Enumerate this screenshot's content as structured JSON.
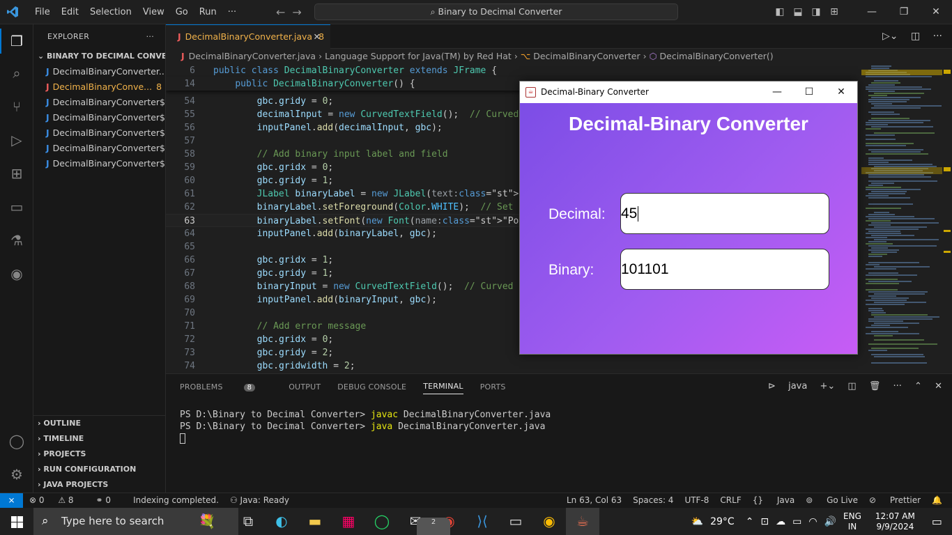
{
  "titlebar": {
    "menu": [
      "File",
      "Edit",
      "Selection",
      "View",
      "Go",
      "Run",
      "···"
    ],
    "command_center": "Binary to Decimal Converter"
  },
  "sidebar": {
    "header": "EXPLORER",
    "more": "···",
    "folder": "BINARY TO DECIMAL CONVER...",
    "files": [
      {
        "name": "DecimalBinaryConverter....",
        "error": false,
        "badge": ""
      },
      {
        "name": "DecimalBinaryConve...",
        "error": true,
        "badge": "8"
      },
      {
        "name": "DecimalBinaryConverter$...",
        "error": false,
        "badge": ""
      },
      {
        "name": "DecimalBinaryConverter$...",
        "error": false,
        "badge": ""
      },
      {
        "name": "DecimalBinaryConverter$...",
        "error": false,
        "badge": ""
      },
      {
        "name": "DecimalBinaryConverter$...",
        "error": false,
        "badge": ""
      },
      {
        "name": "DecimalBinaryConverter$...",
        "error": false,
        "badge": ""
      }
    ],
    "bottom_sections": [
      "OUTLINE",
      "TIMELINE",
      "PROJECTS",
      "RUN CONFIGURATION",
      "JAVA PROJECTS"
    ]
  },
  "editor": {
    "tab_label": "DecimalBinaryConverter.java",
    "tab_badge": "8",
    "breadcrumb": [
      "DecimalBinaryConverter.java",
      "Language Support for Java(TM) by Red Hat",
      "DecimalBinaryConverter",
      "DecimalBinaryConverter()"
    ],
    "sticky_lines": [
      {
        "n": "6",
        "code": "public class DecimalBinaryConverter extends JFrame {"
      },
      {
        "n": "14",
        "code": "    public DecimalBinaryConverter() {"
      }
    ],
    "lines": [
      {
        "n": "54",
        "code": "        gbc.gridy = 0;"
      },
      {
        "n": "55",
        "code": "        decimalInput = new CurvedTextField();  // Curved"
      },
      {
        "n": "56",
        "code": "        inputPanel.add(decimalInput, gbc);"
      },
      {
        "n": "57",
        "code": ""
      },
      {
        "n": "58",
        "code": "        // Add binary input label and field"
      },
      {
        "n": "59",
        "code": "        gbc.gridx = 0;"
      },
      {
        "n": "60",
        "code": "        gbc.gridy = 1;"
      },
      {
        "n": "61",
        "code": "        JLabel binaryLabel = new JLabel(text:\"Binary:\");"
      },
      {
        "n": "62",
        "code": "        binaryLabel.setForeground(Color.WHITE);  // Set t"
      },
      {
        "n": "63",
        "code": "        binaryLabel.setFont(new Font(name:\"Poppins\", Font"
      },
      {
        "n": "64",
        "code": "        inputPanel.add(binaryLabel, gbc);"
      },
      {
        "n": "65",
        "code": ""
      },
      {
        "n": "66",
        "code": "        gbc.gridx = 1;"
      },
      {
        "n": "67",
        "code": "        gbc.gridy = 1;"
      },
      {
        "n": "68",
        "code": "        binaryInput = new CurvedTextField();  // Curved b"
      },
      {
        "n": "69",
        "code": "        inputPanel.add(binaryInput, gbc);"
      },
      {
        "n": "70",
        "code": ""
      },
      {
        "n": "71",
        "code": "        // Add error message"
      },
      {
        "n": "72",
        "code": "        gbc.gridx = 0;"
      },
      {
        "n": "73",
        "code": "        gbc.gridy = 2;"
      },
      {
        "n": "74",
        "code": "        gbc.gridwidth = 2;"
      }
    ]
  },
  "panel": {
    "tabs": [
      "PROBLEMS",
      "OUTPUT",
      "DEBUG CONSOLE",
      "TERMINAL",
      "PORTS"
    ],
    "problems_count": "8",
    "active_tab": "TERMINAL",
    "terminal_shell": "java",
    "terminal": {
      "prompt": "PS D:\\Binary to Decimal Converter>",
      "cmd1": "javac",
      "arg1": "DecimalBinaryConverter.java",
      "cmd2": "java",
      "arg2": "DecimalBinaryConverter.java"
    }
  },
  "statusbar": {
    "errors": "0",
    "warnings": "8",
    "ports": "0",
    "indexing": "Indexing completed.",
    "java_status": "Java: Ready",
    "position": "Ln 63, Col 63",
    "spaces": "Spaces: 4",
    "encoding": "UTF-8",
    "eol": "CRLF",
    "language": "Java",
    "golive": "Go Live",
    "prettier": "Prettier"
  },
  "java_window": {
    "title": "Decimal-Binary Converter",
    "heading": "Decimal-Binary Converter",
    "decimal_label": "Decimal:",
    "decimal_value": "45",
    "binary_label": "Binary:",
    "binary_value": "101101"
  },
  "taskbar": {
    "search_placeholder": "Type here to search",
    "mail_badge": "2",
    "weather": "29°C",
    "lang_line1": "ENG",
    "lang_line2": "IN",
    "time": "12:07 AM",
    "date": "9/9/2024"
  }
}
